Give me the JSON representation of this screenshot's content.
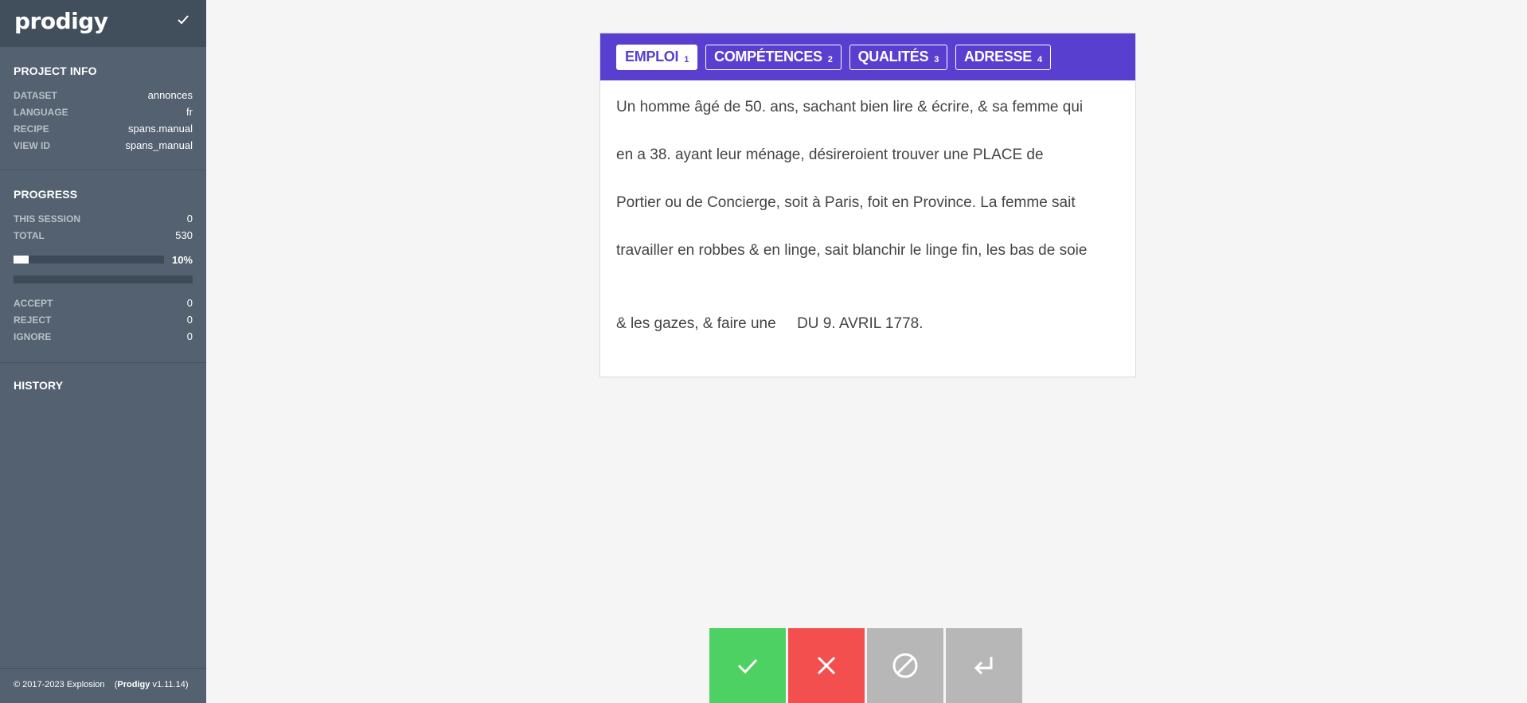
{
  "app": {
    "logo": "prodigy",
    "header_icon": "check-icon"
  },
  "project_info": {
    "title": "PROJECT INFO",
    "rows": [
      {
        "key": "DATASET",
        "value": "annonces"
      },
      {
        "key": "LANGUAGE",
        "value": "fr"
      },
      {
        "key": "RECIPE",
        "value": "spans.manual"
      },
      {
        "key": "VIEW ID",
        "value": "spans_manual"
      }
    ]
  },
  "progress": {
    "title": "PROGRESS",
    "this_session_key": "THIS SESSION",
    "this_session_value": "0",
    "total_key": "TOTAL",
    "total_value": "530",
    "percent_label": "10%",
    "percent_value": 0.1,
    "accept_key": "ACCEPT",
    "accept_value": "0",
    "reject_key": "REJECT",
    "reject_value": "0",
    "ignore_key": "IGNORE",
    "ignore_value": "0"
  },
  "history": {
    "title": "HISTORY"
  },
  "footer": {
    "copyright": "© 2017-2023 Explosion",
    "product": "Prodigy",
    "version": "v1.11.14"
  },
  "labels": [
    {
      "name": "EMPLOI",
      "key": "1",
      "active": true
    },
    {
      "name": "COMPÉTENCES",
      "key": "2",
      "active": false
    },
    {
      "name": "QUALITÉS",
      "key": "3",
      "active": false
    },
    {
      "name": "ADRESSE",
      "key": "4",
      "active": false
    }
  ],
  "text_lines": [
    "Un homme âgé de 50. ans, sachant bien lire & écrire, & sa femme qui",
    "en a 38. ayant leur ménage, désireroient trouver une PLACE de",
    "Portier ou de Concierge, soit à Paris, foit en Province. La femme sait",
    "travailler en robbes & en linge, sait blanchir le linge fin, les bas de soie",
    "& les gazes, & faire une     DU 9. AVRIL 1778."
  ],
  "actions": {
    "accept_icon": "check-icon",
    "reject_icon": "close-icon",
    "ignore_icon": "ignore-icon",
    "undo_icon": "undo-icon",
    "colors": {
      "accept": "#4ed163",
      "reject": "#f44f4f",
      "ignore": "#b7b7b7",
      "undo": "#b7b7b7"
    }
  },
  "theme": {
    "accent": "#583fcf",
    "sidebar": "#546170",
    "sidebar_header": "#414e5b"
  }
}
